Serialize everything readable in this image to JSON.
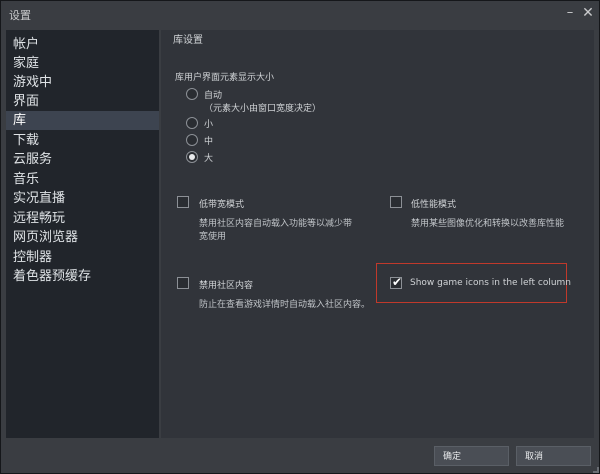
{
  "window": {
    "title": "设置",
    "minimize_glyph": "–",
    "close_glyph": "✕"
  },
  "sidebar": {
    "items": [
      {
        "label": "帐户"
      },
      {
        "label": "家庭"
      },
      {
        "label": "游戏中"
      },
      {
        "label": "界面"
      },
      {
        "label": "库",
        "active": true
      },
      {
        "label": "下载"
      },
      {
        "label": "云服务"
      },
      {
        "label": "音乐"
      },
      {
        "label": "实况直播"
      },
      {
        "label": "远程畅玩"
      },
      {
        "label": "网页浏览器"
      },
      {
        "label": "控制器"
      },
      {
        "label": "着色器预缓存"
      }
    ]
  },
  "main": {
    "section_title": "库设置",
    "size_group_label": "库用户界面元素显示大小",
    "size_options": [
      {
        "label": "自动",
        "sublabel": "（元素大小由窗口宽度决定）",
        "checked": false
      },
      {
        "label": "小",
        "checked": false
      },
      {
        "label": "中",
        "checked": false
      },
      {
        "label": "大",
        "checked": true
      }
    ],
    "low_bandwidth": {
      "label": "低带宽模式",
      "desc_line1": "禁用社区内容自动载入功能等以减少带",
      "desc_line2": "宽使用",
      "checked": false
    },
    "low_performance": {
      "label": "低性能模式",
      "desc": "禁用某些图像优化和转换以改善库性能",
      "checked": false
    },
    "disable_community": {
      "label": "禁用社区内容",
      "desc": "防止在查看游戏详情时自动载入社区内容。",
      "checked": false
    },
    "show_game_icons": {
      "label": "Show game icons in the left column",
      "checked": true
    }
  },
  "footer": {
    "ok_label": "确定",
    "cancel_label": "取消"
  },
  "colors": {
    "window_bg": "#3a3d42",
    "sidebar_bg": "#21252b",
    "content_bg": "#31343a",
    "active_item_bg": "#3d4450",
    "highlight_border": "#c0392b"
  }
}
